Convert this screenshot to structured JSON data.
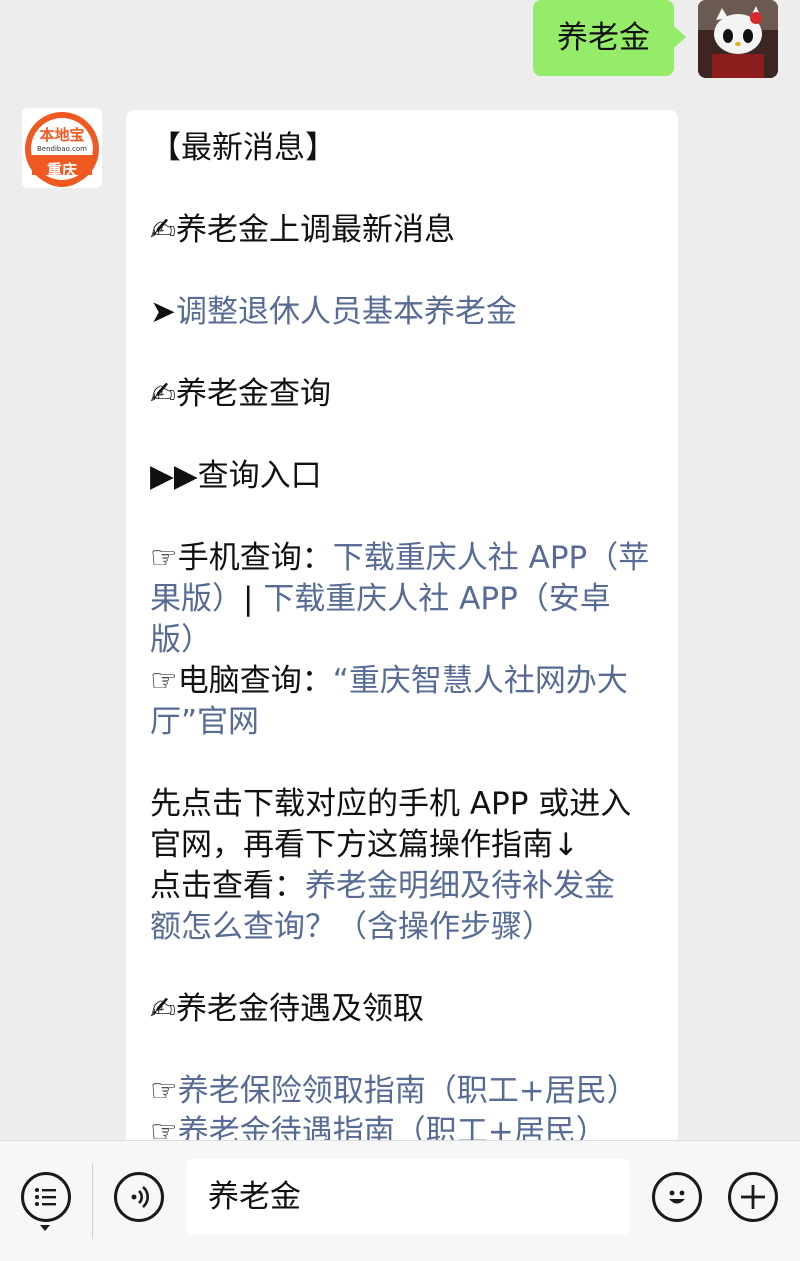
{
  "outgoing": {
    "text": "养老金"
  },
  "incoming": {
    "avatar": {
      "top_text": "本地宝",
      "sub_text": "Bendibao.com",
      "city": "重庆"
    },
    "segments": [
      {
        "type": "text",
        "value": "【最新消息】"
      },
      {
        "type": "gap"
      },
      {
        "type": "text",
        "value": "✍养老金上调最新消息"
      },
      {
        "type": "gap"
      },
      {
        "type": "mixed",
        "parts": [
          {
            "t": "➤"
          },
          {
            "t": "调整退休人员基本养老金",
            "link": true
          }
        ]
      },
      {
        "type": "gap"
      },
      {
        "type": "text",
        "value": "✍养老金查询"
      },
      {
        "type": "gap"
      },
      {
        "type": "text",
        "value": "▶▶查询入口"
      },
      {
        "type": "gap"
      },
      {
        "type": "mixed",
        "parts": [
          {
            "t": "☞手机查询："
          },
          {
            "t": "下载重庆人社 APP（苹",
            "link": true
          }
        ]
      },
      {
        "type": "mixed",
        "parts": [
          {
            "t": "果版）",
            "link": true
          },
          {
            "t": "| "
          },
          {
            "t": "下载重庆人社 APP（安卓",
            "link": true
          }
        ]
      },
      {
        "type": "mixed",
        "parts": [
          {
            "t": "版）",
            "link": true
          }
        ]
      },
      {
        "type": "mixed",
        "parts": [
          {
            "t": "☞电脑查询："
          },
          {
            "t": "“重庆智慧人社网办大",
            "link": true
          }
        ]
      },
      {
        "type": "mixed",
        "parts": [
          {
            "t": "厅”官网",
            "link": true
          }
        ]
      },
      {
        "type": "gap"
      },
      {
        "type": "text",
        "value": "先点击下载对应的手机 APP 或进入"
      },
      {
        "type": "text",
        "value": "官网，再看下方这篇操作指南↓"
      },
      {
        "type": "mixed",
        "parts": [
          {
            "t": "点击查看："
          },
          {
            "t": "养老金明细及待补发金",
            "link": true
          }
        ]
      },
      {
        "type": "mixed",
        "parts": [
          {
            "t": "额怎么查询？（含操作步骤）",
            "link": true
          }
        ]
      },
      {
        "type": "gap"
      },
      {
        "type": "text",
        "value": "✍养老金待遇及领取"
      },
      {
        "type": "gap"
      },
      {
        "type": "mixed",
        "parts": [
          {
            "t": "☞"
          },
          {
            "t": "养老保险领取指南（职工+居民）",
            "link": true
          }
        ]
      },
      {
        "type": "mixed",
        "parts": [
          {
            "t": "☞"
          },
          {
            "t": "养老金待遇指南（职工+居民）",
            "link": true
          }
        ]
      }
    ]
  },
  "bottom_bar": {
    "menu_icon": "list-menu-icon",
    "voice_icon": "voice-icon",
    "input_value": "养老金",
    "emoji_icon": "emoji-icon",
    "add_icon": "plus-icon"
  }
}
